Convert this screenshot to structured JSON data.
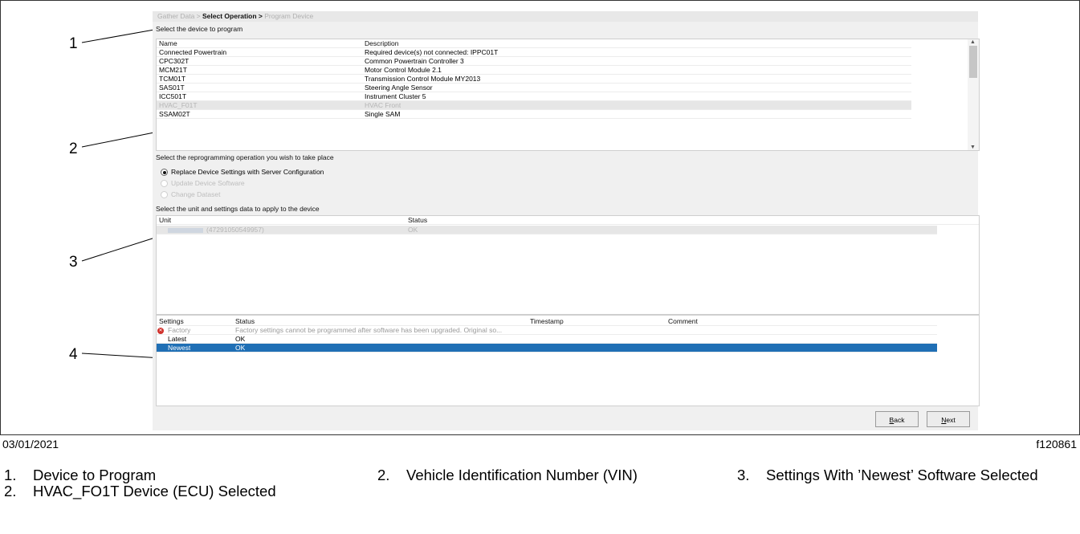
{
  "breadcrumb": {
    "step1": "Gather Data >",
    "step2": "Select Operation >",
    "step3": "Program Device"
  },
  "device_section": {
    "label": "Select the device to program",
    "columns": [
      "Name",
      "Description"
    ],
    "rows": [
      {
        "name": "Connected Powertrain",
        "description": "Required device(s) not connected: IPPC01T"
      },
      {
        "name": "CPC302T",
        "description": "Common Powertrain Controller 3"
      },
      {
        "name": "MCM21T",
        "description": "Motor Control Module 2.1"
      },
      {
        "name": "TCM01T",
        "description": "Transmission Control Module MY2013"
      },
      {
        "name": "SAS01T",
        "description": "Steering Angle Sensor"
      },
      {
        "name": "ICC501T",
        "description": "Instrument Cluster 5"
      },
      {
        "name": "HVAC_F01T",
        "description": "HVAC Front"
      },
      {
        "name": "SSAM02T",
        "description": "Single SAM"
      }
    ]
  },
  "operation_section": {
    "label": "Select the reprogramming operation you wish to take place",
    "options": [
      {
        "label": "Replace Device Settings with Server Configuration",
        "selected": true,
        "enabled": true
      },
      {
        "label": "Update Device Software",
        "selected": false,
        "enabled": false
      },
      {
        "label": "Change Dataset",
        "selected": false,
        "enabled": false
      }
    ]
  },
  "unit_section": {
    "label": "Select the unit and settings data to apply to the device",
    "columns": [
      "Unit",
      "Status"
    ],
    "rows": [
      {
        "unit": "(47291050549957)",
        "status": "OK"
      }
    ]
  },
  "settings_section": {
    "columns": [
      "Settings",
      "Status",
      "Timestamp",
      "Comment"
    ],
    "rows": [
      {
        "settings": "Factory",
        "status": "Factory settings cannot be programmed after software has been upgraded. Original so...",
        "error": true
      },
      {
        "settings": "Latest",
        "status": "OK"
      },
      {
        "settings": "Newest",
        "status": "OK"
      }
    ]
  },
  "buttons": {
    "back": {
      "mnemonic": "B",
      "rest": "ack"
    },
    "next": {
      "mnemonic": "N",
      "rest": "ext"
    }
  },
  "callouts": [
    "1",
    "2",
    "3",
    "4"
  ],
  "footer": {
    "date": "03/01/2021",
    "figure_id": "f120861"
  },
  "legend": [
    {
      "num": "1.",
      "text": "Device to Program"
    },
    {
      "num": "2.",
      "text": "HVAC_FO1T Device (ECU) Selected"
    },
    {
      "num": "2.",
      "text": "Vehicle Identification Number (VIN)"
    },
    {
      "num": "3.",
      "text": "Settings With ’Newest’ Software Selected"
    }
  ],
  "colors": {
    "selection": "#1f6fb5",
    "error": "#d0302b"
  }
}
